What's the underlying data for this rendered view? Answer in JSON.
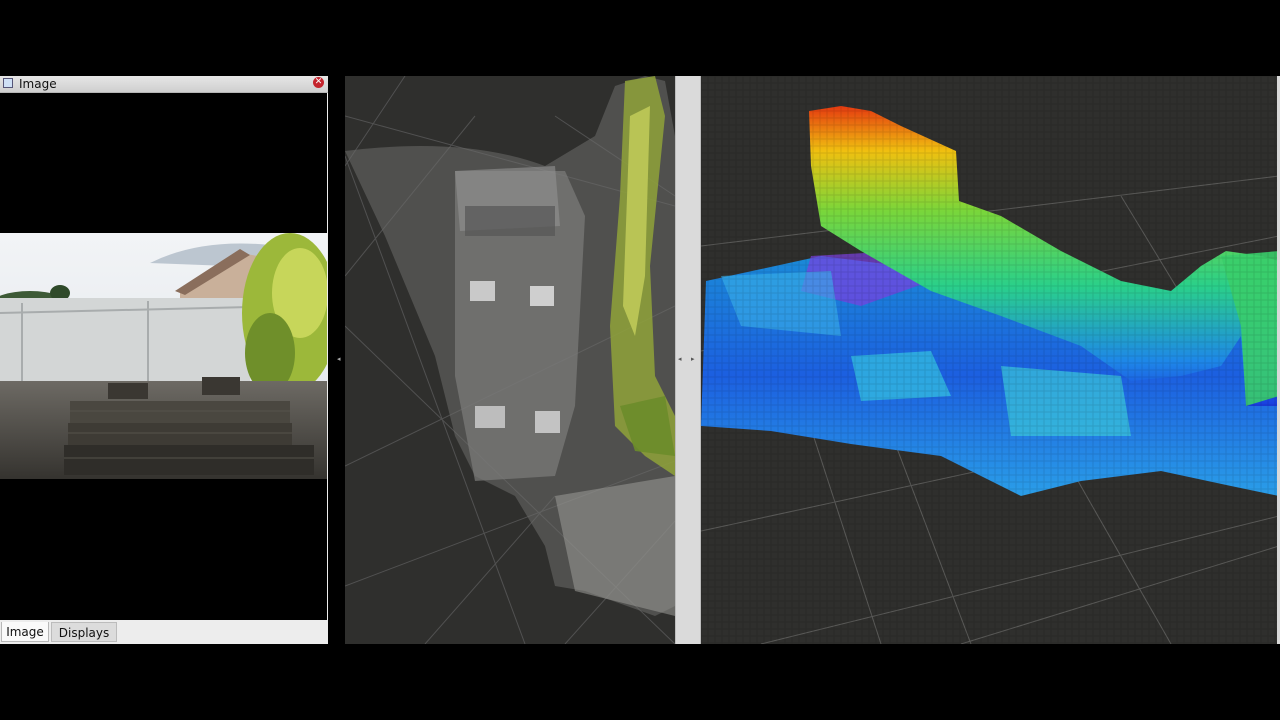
{
  "image_panel": {
    "title": "Image",
    "close_icon": "close-icon",
    "window_icon": "window-icon"
  },
  "tabs": [
    {
      "label": "Image",
      "active": true
    },
    {
      "label": "Displays",
      "active": false
    }
  ],
  "colors": {
    "viewport_bg": "#2f2f2d",
    "panel_bg": "#ededed",
    "close_red": "#c4242d"
  }
}
